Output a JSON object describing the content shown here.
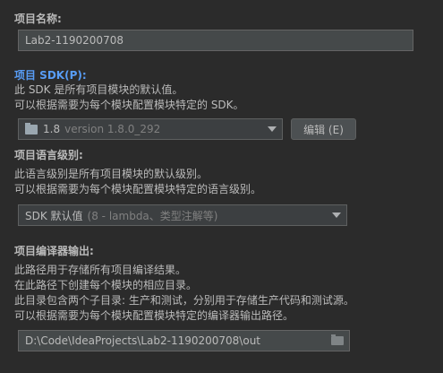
{
  "project_name": {
    "label": "项目名称:",
    "value": "Lab2-1190200708"
  },
  "project_sdk": {
    "label": "项目 SDK(P):",
    "desc_line1": "此 SDK 是所有项目模块的默认值。",
    "desc_line2": "可以根据需要为每个模块配置模块特定的 SDK。",
    "selected_version": "1.8",
    "selected_detail": "version 1.8.0_292",
    "edit_button": "编辑 (E)"
  },
  "language_level": {
    "label": "项目语言级别:",
    "desc_line1": "此语言级别是所有项目模块的默认级别。",
    "desc_line2": "可以根据需要为每个模块配置模块特定的语言级别。",
    "selected_main": "SDK 默认值",
    "selected_detail": "(8 - lambda、类型注解等)"
  },
  "compiler_output": {
    "label": "项目编译器输出:",
    "desc_line1": "此路径用于存储所有项目编译结果。",
    "desc_line2": "在此路径下创建每个模块的相应目录。",
    "desc_line3": "此目录包含两个子目录: 生产和测试，分别用于存储生产代码和测试源。",
    "desc_line4": "可以根据需要为每个模块配置模块特定的编译器输出路径。",
    "path": "D:\\Code\\IdeaProjects\\Lab2-1190200708\\out"
  },
  "colors": {
    "background": "#2b2b2b",
    "accent": "#589df6",
    "field_background": "#45494a"
  },
  "icons": [
    "folder-icon",
    "chevron-down-icon",
    "browse-folder-icon"
  ]
}
